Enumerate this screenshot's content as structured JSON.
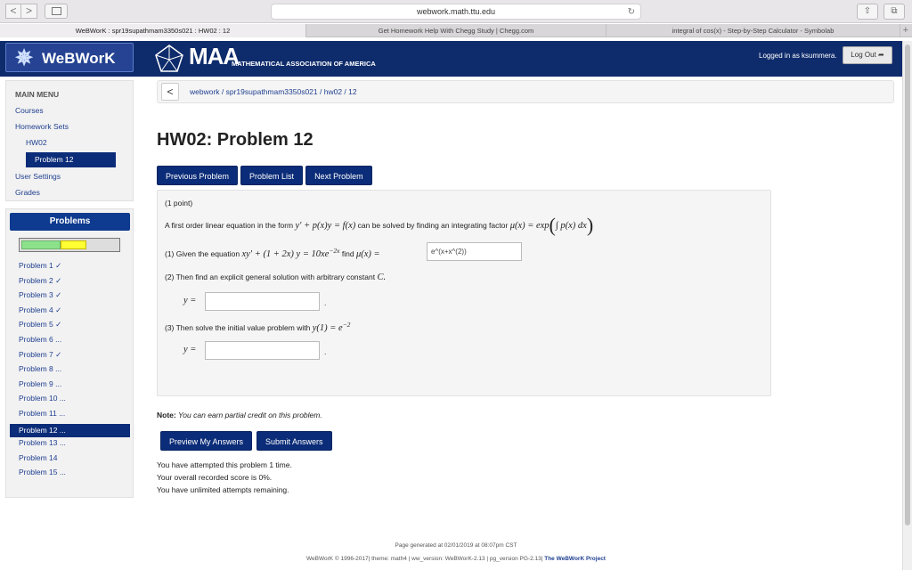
{
  "browser": {
    "url": "webwork.math.ttu.edu",
    "nav_back": "<",
    "nav_forward": ">",
    "tabs": [
      "WeBWorK : spr19supathmam3350s021 : HW02 : 12",
      "Get Homework Help With Chegg Study | Chegg.com",
      "integral of cos(x) - Step-by-Step Calculator - Symbolab"
    ],
    "new_tab": "+"
  },
  "header": {
    "webwork_logo": "WeBWorK",
    "maa_letters": "MAA",
    "maa_subtitle": "MATHEMATICAL ASSOCIATION OF AMERICA",
    "logged_in": "Logged in as ksummera.",
    "logout": "Log Out"
  },
  "menu": {
    "heading": "MAIN MENU",
    "courses": "Courses",
    "homework_sets": "Homework Sets",
    "hw02": "HW02",
    "problem12": "Problem 12",
    "user_settings": "User Settings",
    "grades": "Grades"
  },
  "problems": {
    "title": "Problems",
    "progress": {
      "correct_fraction": 0.4,
      "attempted_fraction": 0.6
    },
    "items": [
      "Problem 1 ✓",
      "Problem 2 ✓",
      "Problem 3 ✓",
      "Problem 4 ✓",
      "Problem 5 ✓",
      "Problem 6 ...",
      "Problem 7 ✓",
      "Problem 8 ...",
      "Problem 9 ...",
      "Problem 10 ...",
      "Problem 11 ...",
      "Problem 12 ...",
      "Problem 13 ...",
      "Problem 14",
      "Problem 15 ..."
    ],
    "active_index": 11
  },
  "breadcrumb": {
    "back": "<",
    "path": "webwork / spr19supathmam3350s021 / hw02 / 12"
  },
  "page_title": "HW02: Problem 12",
  "nav_buttons": {
    "previous": "Previous Problem",
    "list": "Problem List",
    "next": "Next Problem"
  },
  "problem": {
    "points": "(1 point)",
    "intro_prefix": "A first order linear equation in the form",
    "intro_eq": "y′ + p(x)y = f(x)",
    "intro_mid": "can be solved by finding an integrating factor",
    "intro_factor": "μ(x) = exp",
    "intro_integral": "∫ p(x) dx",
    "part1_prefix": "(1) Given the equation",
    "part1_eq": "xy′ + (1 + 2x) y = 10xe",
    "part1_exp": "−2x",
    "part1_find": "find",
    "part1_mu": "μ(x) =",
    "part1_answer": "e^(x+x^(2))",
    "part2": "(2) Then find an explicit general solution with arbitrary constant",
    "part2_const": "C.",
    "y_label": "y =",
    "dot": ".",
    "part3_prefix": "(3) Then solve the initial value problem with",
    "part3_eq": "y(1) = e",
    "part3_exp": "−2"
  },
  "note": {
    "label": "Note:",
    "text": "You can earn partial credit on this problem."
  },
  "submit": {
    "preview": "Preview My Answers",
    "submit": "Submit Answers"
  },
  "status": {
    "attempts": "You have attempted this problem 1 time.",
    "score": "Your overall recorded score is 0%.",
    "remaining": "You have unlimited attempts remaining."
  },
  "footer": {
    "generated": "Page generated at 02/01/2019 at 08:07pm CST",
    "credits": "WeBWorK © 1996-2017| theme: math4 | ww_version: WeBWorK-2.13 | pg_version PG-2.13|",
    "project": "The WeBWorK Project"
  },
  "colors": {
    "header_bg": "#0e2b6b",
    "button_blue": "#0b2c78",
    "link_blue": "#1f3f8f",
    "progress_green": "#8ce28a",
    "progress_yellow": "#ffff33"
  }
}
